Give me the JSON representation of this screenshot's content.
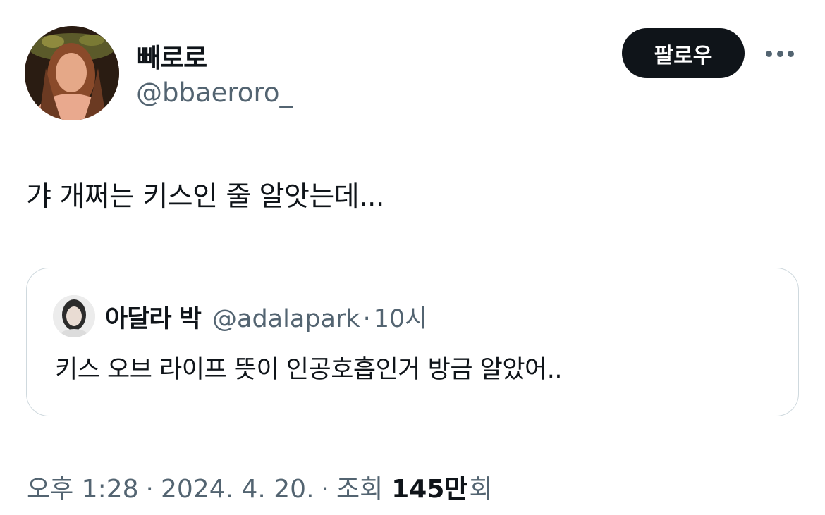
{
  "author": {
    "display_name": "빼로로",
    "handle": "@bbaeroro_"
  },
  "actions": {
    "follow_label": "팔로우",
    "more_icon": "more-horizontal-icon"
  },
  "tweet": {
    "text": "갸 개쩌는 키스인 줄 알앗는데..."
  },
  "quoted_tweet": {
    "display_name": "아달라 박",
    "handle": "@adalapark",
    "separator": "·",
    "time": "10시",
    "text": "키스 오브 라이프 뜻이 인공호흡인거 방금 알았어.."
  },
  "meta": {
    "time": "오후 1:28",
    "separator": "·",
    "date": "2024. 4. 20.",
    "views_label": "조회",
    "views_count": "145만",
    "views_suffix": "회"
  },
  "colors": {
    "text_primary": "#0f1419",
    "text_secondary": "#536471",
    "border": "#cfd9de",
    "follow_bg": "#0f1419"
  }
}
